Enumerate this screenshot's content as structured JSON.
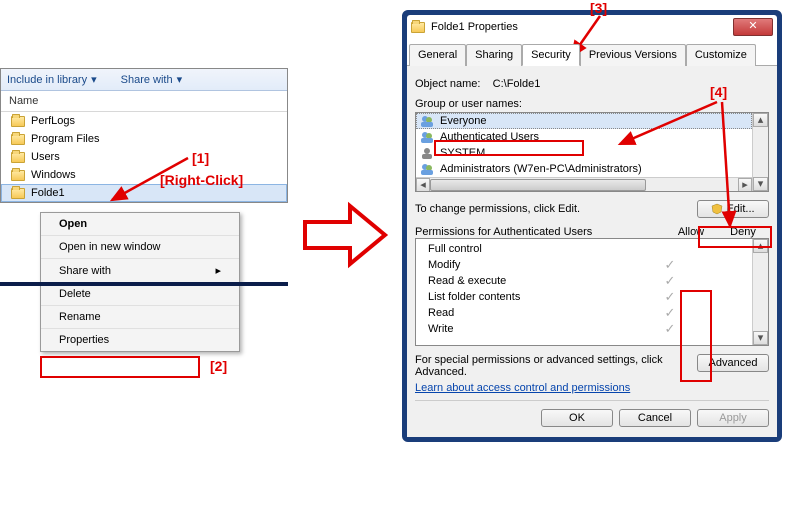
{
  "explorer": {
    "toolbar": {
      "include": "Include in library",
      "share": "Share with"
    },
    "column_name": "Name",
    "items": [
      "PerfLogs",
      "Program Files",
      "Users",
      "Windows",
      "Folde1"
    ]
  },
  "context_menu": {
    "open": "Open",
    "open_new": "Open in new window",
    "share_with": "Share with",
    "delete": "Delete",
    "rename": "Rename",
    "properties": "Properties"
  },
  "annotations": {
    "n1": "[1]",
    "rc": "[Right-Click]",
    "n2": "[2]",
    "n3": "[3]",
    "n4": "[4]"
  },
  "dialog": {
    "title": "Folde1 Properties",
    "tabs": [
      "General",
      "Sharing",
      "Security",
      "Previous Versions",
      "Customize"
    ],
    "object_label": "Object name:",
    "object_value": "C:\\Folde1",
    "groups_label": "Group or user names:",
    "users": [
      "Everyone",
      "Authenticated Users",
      "SYSTEM",
      "Administrators (W7en-PC\\Administrators)"
    ],
    "edit_hint": "To change permissions, click Edit.",
    "edit_btn": "Edit...",
    "perm_header_label": "Permissions for Authenticated Users",
    "allow": "Allow",
    "deny": "Deny",
    "perms": [
      "Full control",
      "Modify",
      "Read & execute",
      "List folder contents",
      "Read",
      "Write"
    ],
    "adv_text": "For special permissions or advanced settings, click Advanced.",
    "adv_btn": "Advanced",
    "learn_link": "Learn about access control and permissions",
    "ok": "OK",
    "cancel": "Cancel",
    "apply": "Apply"
  },
  "icons": {
    "close": "✕",
    "tri_down": "▾",
    "tri_right": "▸",
    "check": "✓",
    "up": "▴",
    "left": "◂"
  }
}
